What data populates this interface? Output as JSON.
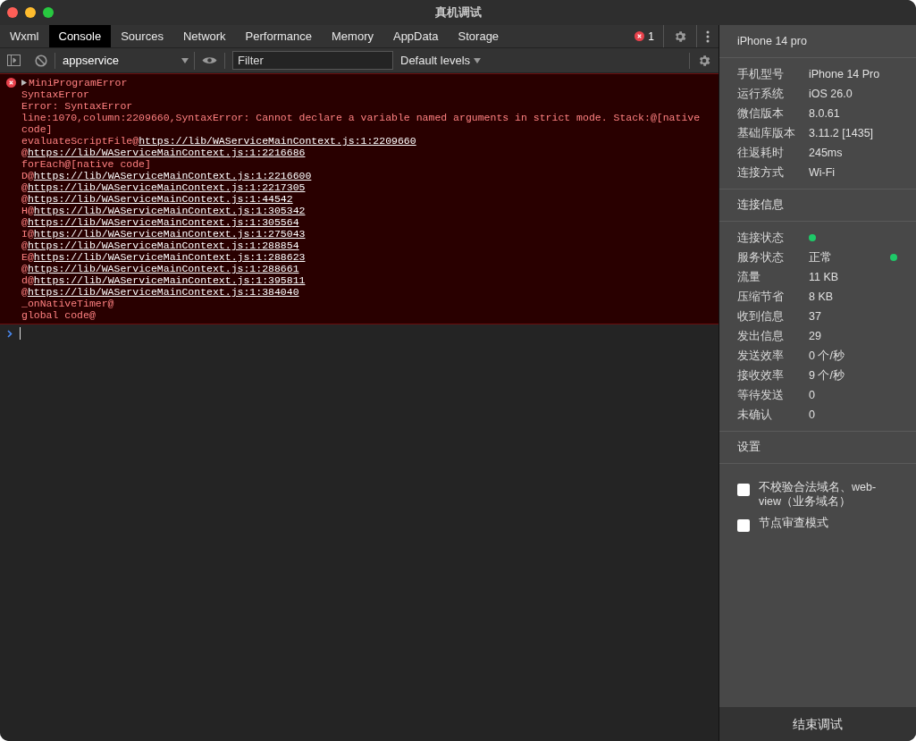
{
  "window": {
    "title": "真机调试"
  },
  "tabs": [
    {
      "label": "Wxml",
      "selected": false
    },
    {
      "label": "Console",
      "selected": true
    },
    {
      "label": "Sources",
      "selected": false
    },
    {
      "label": "Network",
      "selected": false
    },
    {
      "label": "Performance",
      "selected": false
    },
    {
      "label": "Memory",
      "selected": false
    },
    {
      "label": "AppData",
      "selected": false
    },
    {
      "label": "Storage",
      "selected": false
    }
  ],
  "error_count": "1",
  "toolbar": {
    "context": "appservice",
    "filter": {
      "placeholder": "Filter"
    },
    "levels": "Default levels"
  },
  "console": {
    "error": {
      "title": "MiniProgramError",
      "lines": [
        {
          "text": "SyntaxError"
        },
        {
          "text": "Error: SyntaxError"
        },
        {
          "text": "line:1070,column:2209660,SyntaxError: Cannot declare a variable named arguments in strict mode. Stack:@[native code]"
        },
        {
          "text": "evaluateScriptFile@",
          "link": "https://lib/WAServiceMainContext.js:1:2209660"
        },
        {
          "text": "@",
          "link": "https://lib/WAServiceMainContext.js:1:2216686"
        },
        {
          "text": "forEach@[native code]"
        },
        {
          "text": "D@",
          "link": "https://lib/WAServiceMainContext.js:1:2216600"
        },
        {
          "text": "@",
          "link": "https://lib/WAServiceMainContext.js:1:2217305"
        },
        {
          "text": "@",
          "link": "https://lib/WAServiceMainContext.js:1:44542"
        },
        {
          "text": "H@",
          "link": "https://lib/WAServiceMainContext.js:1:305342"
        },
        {
          "text": "@",
          "link": "https://lib/WAServiceMainContext.js:1:305564"
        },
        {
          "text": "I@",
          "link": "https://lib/WAServiceMainContext.js:1:275043"
        },
        {
          "text": "@",
          "link": "https://lib/WAServiceMainContext.js:1:288854"
        },
        {
          "text": "E@",
          "link": "https://lib/WAServiceMainContext.js:1:288623"
        },
        {
          "text": "@",
          "link": "https://lib/WAServiceMainContext.js:1:288661"
        },
        {
          "text": "d@",
          "link": "https://lib/WAServiceMainContext.js:1:395811"
        },
        {
          "text": "@",
          "link": "https://lib/WAServiceMainContext.js:1:384040"
        },
        {
          "text": "_onNativeTimer@"
        },
        {
          "text": "global code@"
        }
      ]
    }
  },
  "device": {
    "name": "iPhone 14 pro",
    "info": [
      {
        "label": "手机型号",
        "value": "iPhone 14 Pro"
      },
      {
        "label": "运行系统",
        "value": "iOS 26.0"
      },
      {
        "label": "微信版本",
        "value": "8.0.61"
      },
      {
        "label": "基础库版本",
        "value": "3.11.2 [1435]"
      },
      {
        "label": "往返耗时",
        "value": "245ms"
      },
      {
        "label": "连接方式",
        "value": "Wi-Fi"
      }
    ]
  },
  "connection": {
    "title": "连接信息",
    "rows": [
      {
        "label": "连接状态",
        "kind": "dot",
        "color": "#1ec968"
      },
      {
        "label": "服务状态",
        "kind": "value_dot",
        "value": "正常",
        "color": "#1ec968"
      },
      {
        "label": "流量",
        "kind": "value",
        "value": "11 KB"
      },
      {
        "label": "压缩节省",
        "kind": "value",
        "value": "8 KB"
      },
      {
        "label": "收到信息",
        "kind": "value",
        "value": "37"
      },
      {
        "label": "发出信息",
        "kind": "value",
        "value": "29"
      },
      {
        "label": "发送效率",
        "kind": "value",
        "value": "0 个/秒"
      },
      {
        "label": "接收效率",
        "kind": "value",
        "value": "9 个/秒"
      },
      {
        "label": "等待发送",
        "kind": "value",
        "value": "0"
      },
      {
        "label": "未确认",
        "kind": "value",
        "value": "0"
      }
    ]
  },
  "settings": {
    "title": "设置",
    "options": [
      {
        "label": "不校验合法域名、web-view（业务域名）",
        "checked": false
      },
      {
        "label": "节点审查模式",
        "checked": false
      }
    ]
  },
  "end_button": "结束调试"
}
